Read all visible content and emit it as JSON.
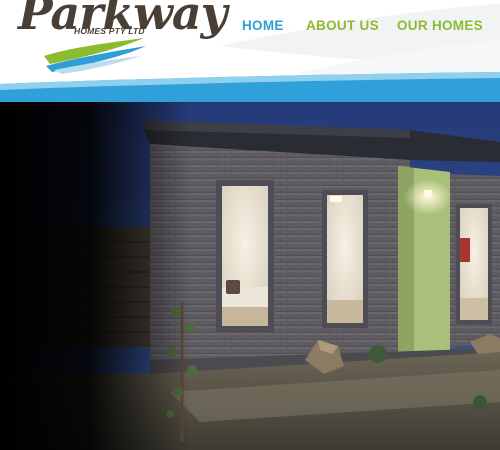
{
  "brand": {
    "name": "Parkway",
    "tagline": "HOMES PTY LTD",
    "colors": {
      "navy": "#4a3f35",
      "blue": "#2e9fd6",
      "green": "#8cbb2f"
    }
  },
  "nav": {
    "items": [
      {
        "label": "HOME",
        "active": true
      },
      {
        "label": "ABOUT US",
        "active": false
      },
      {
        "label": "OUR HOMES",
        "active": false
      }
    ]
  },
  "hero": {
    "description_icon": "house-photo"
  }
}
